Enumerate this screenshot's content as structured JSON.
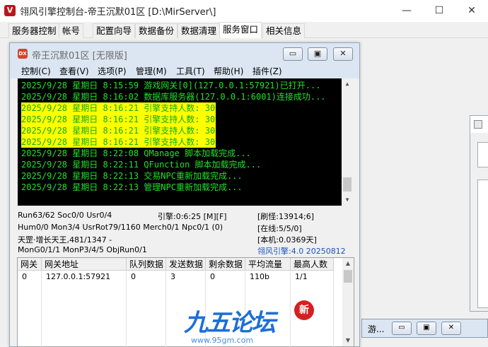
{
  "window": {
    "title": "翎风引擎控制台-帝王沉默01区 [D:\\MirServer\\]",
    "min_glyph": "—",
    "max_glyph": "☐",
    "close_glyph": "✕"
  },
  "main_tabs": [
    {
      "label": "服务器控制"
    },
    {
      "label": "帐号"
    },
    {
      "label": "配置向导"
    },
    {
      "label": "数据备份"
    },
    {
      "label": "数据清理"
    },
    {
      "label": "服务窗口"
    },
    {
      "label": "相关信息"
    }
  ],
  "child": {
    "title": "帝王沉默01区 [无限版]",
    "menu": [
      "控制(C)",
      "查看(V)",
      "选项(P)",
      "管理(M)",
      "工具(T)",
      "帮助(H)",
      "插件(Z)"
    ],
    "min_glyph": "▭",
    "max_glyph": "▣",
    "close_glyph": "✕"
  },
  "console": {
    "lines": [
      "2025/9/28 星期日 8:15:59 游戏网关[0](127.0.0.1:57921)已打开...",
      "2025/9/28 星期日 8:16:02 数据库服务器(127.0.0.1:6001)连接成功...",
      "2025/9/28 星期日 8:16:21 引擎支持人数: 30",
      "2025/9/28 星期日 8:16:21 引擎支持人数: 30",
      "2025/9/28 星期日 8:16:21 引擎支持人数: 30",
      "2025/9/28 星期日 8:16:21 引擎支持人数: 30",
      "2025/9/28 星期日 8:22:08 QManage 脚本加载完成...",
      "2025/9/28 星期日 8:22:11 QFunction 脚本加载完成...",
      "2025/9/28 星期日 8:22:13 交易NPC重新加载完成...",
      "2025/9/28 星期日 8:22:13 管理NPC重新加载完成..."
    ],
    "highlighted_lines": [
      2,
      3,
      4,
      5
    ],
    "text_color": "#22e02a",
    "highlight_color": "#ffff00"
  },
  "status": {
    "run": "Run63/62 Soc0/0 Usr0/4",
    "engine": "引擎:0:6:25 [M][F]",
    "refresh": "[刷怪:13914;6]",
    "hum": "Hum0/0 Mon3/4 UsrRot79/1160 Merch0/1 Npc0/1 (0)",
    "online": "[在线:5/5/0]",
    "tianzhao": "天罡·增长天王,481/1347 -",
    "local": "[本机:0.0369天]",
    "mon": "MonG0/1/1 MonP3/4/5 ObjRun0/1",
    "version": "翎风引擎:4.0 20250812"
  },
  "gateway_table": {
    "headers": [
      "网关",
      "网关地址",
      "队列数据",
      "发送数据",
      "剩余数据",
      "平均流量",
      "最高人数"
    ],
    "rows": [
      [
        "0",
        "127.0.0.1:57921",
        "0",
        "3",
        "0",
        "110b",
        "1/1"
      ]
    ]
  },
  "taskwin": {
    "label": "游..."
  },
  "watermark": {
    "text": "九五论坛",
    "badge": "新",
    "url": "www.95gm.com"
  }
}
